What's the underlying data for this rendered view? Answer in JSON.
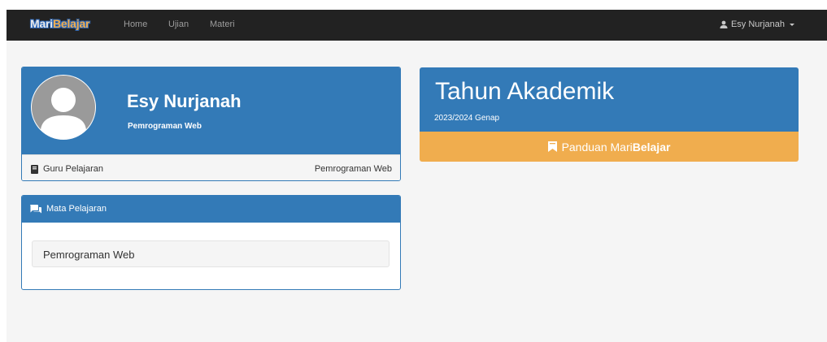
{
  "navbar": {
    "brand_part1": "Mari",
    "brand_part2": "Belajar",
    "links": [
      "Home",
      "Ujian",
      "Materi"
    ],
    "user_name": "Esy Nurjanah"
  },
  "profile": {
    "name": "Esy Nurjanah",
    "subtitle": "Pemrograman Web",
    "footer_label": "Guru Pelajaran",
    "footer_value": "Pemrograman Web"
  },
  "mata_pelajaran": {
    "title": "Mata Pelajaran",
    "items": [
      "Pemrograman Web"
    ]
  },
  "tahun_akademik": {
    "title": "Tahun Akademik",
    "period": "2023/2024 Genap"
  },
  "panduan": {
    "label_prefix": "Panduan Mari",
    "label_bold": "Belajar"
  },
  "colors": {
    "navbar": "#222222",
    "primary": "#337ab7",
    "warning": "#f0ad4e",
    "page_bg": "#f5f5f5"
  },
  "icons": {
    "user": "user-icon",
    "book": "book-icon",
    "comments": "comments-icon",
    "bookmark": "bookmark-icon"
  }
}
